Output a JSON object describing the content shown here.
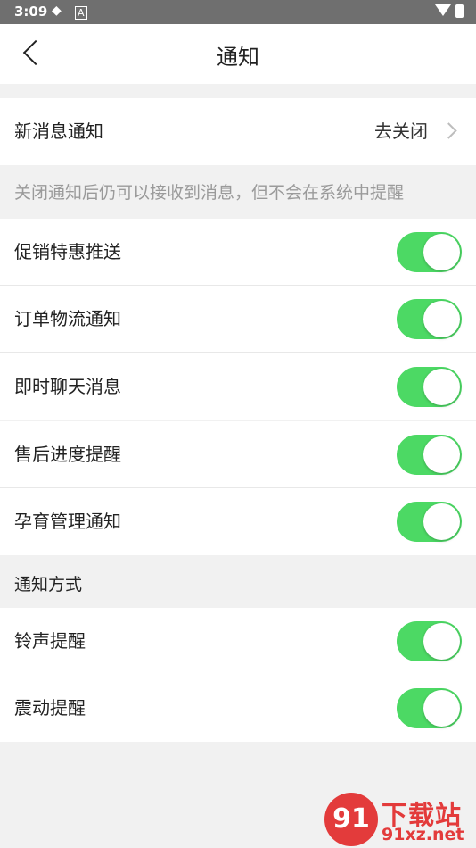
{
  "status_bar": {
    "time": "3:09"
  },
  "header": {
    "title": "通知"
  },
  "new_message": {
    "label": "新消息通知",
    "action": "去关闭"
  },
  "notice_hint": "关闭通知后仍可以接收到消息，但不会在系统中提醒",
  "toggles": [
    {
      "label": "促销特惠推送",
      "on": true
    },
    {
      "label": "订单物流通知",
      "on": true
    },
    {
      "label": "即时聊天消息",
      "on": true
    },
    {
      "label": "售后进度提醒",
      "on": true
    },
    {
      "label": "孕育管理通知",
      "on": true
    }
  ],
  "method_section": {
    "title": "通知方式"
  },
  "method_toggles": [
    {
      "label": "铃声提醒",
      "on": true
    },
    {
      "label": "震动提醒",
      "on": true
    }
  ],
  "watermark": {
    "name": "下载站",
    "domain": "91xz.net"
  },
  "colors": {
    "accent": "#4cd964",
    "background": "#f1f1f1",
    "hint": "#9a9a9a"
  }
}
